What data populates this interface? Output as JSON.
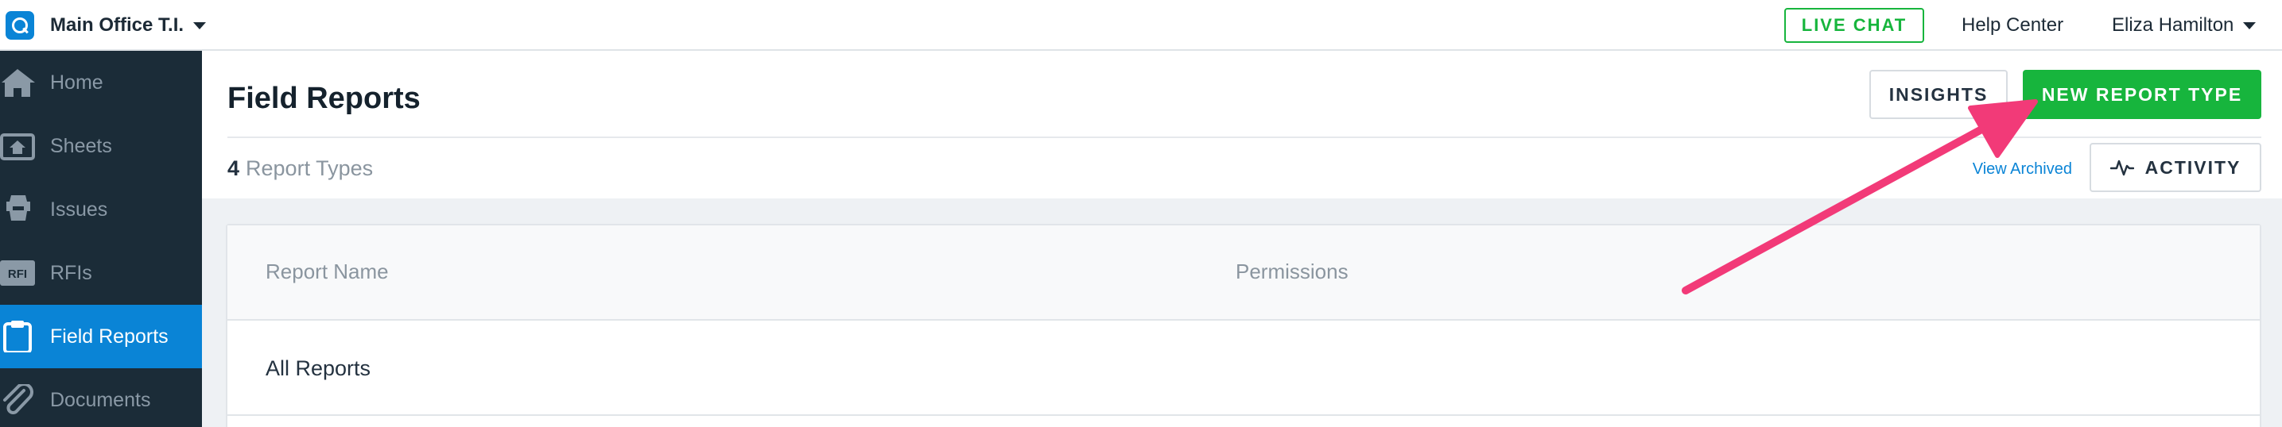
{
  "topbar": {
    "project_name": "Main Office T.I.",
    "live_chat_label": "LIVE CHAT",
    "help_center_label": "Help Center",
    "user_name": "Eliza Hamilton"
  },
  "sidebar": {
    "items": [
      {
        "label": "Home",
        "icon": "home-icon"
      },
      {
        "label": "Sheets",
        "icon": "sheets-icon"
      },
      {
        "label": "Issues",
        "icon": "issues-icon"
      },
      {
        "label": "RFIs",
        "icon": "rfi-icon",
        "icon_text": "RFI"
      },
      {
        "label": "Field Reports",
        "icon": "clipboard-icon",
        "active": true
      },
      {
        "label": "Documents",
        "icon": "paperclip-icon"
      }
    ]
  },
  "header": {
    "title": "Field Reports",
    "insights_label": "INSIGHTS",
    "new_report_type_label": "NEW REPORT TYPE",
    "report_count": "4",
    "report_count_label": "Report Types",
    "view_archived_label": "View Archived",
    "activity_label": "ACTIVITY"
  },
  "table": {
    "columns": [
      "Report Name",
      "Permissions"
    ],
    "rows": [
      {
        "name": "All Reports",
        "permissions": ""
      }
    ]
  },
  "colors": {
    "accent_blue": "#0a84d6",
    "brand_green": "#17b53d",
    "sidebar_bg": "#1b2c38",
    "annotation_pink": "#f23a78"
  }
}
